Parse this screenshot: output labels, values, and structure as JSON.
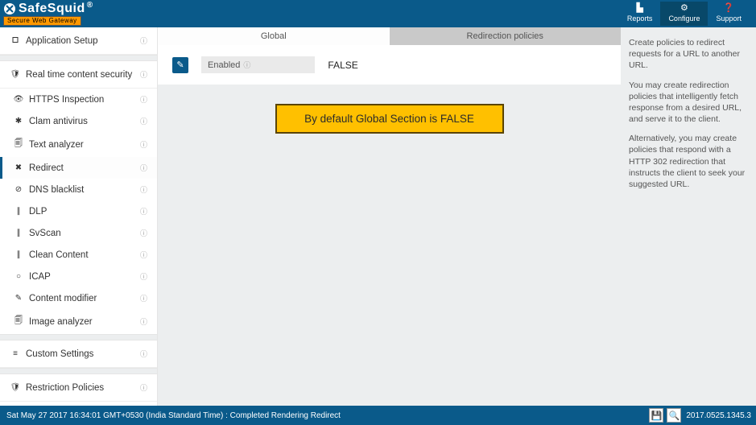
{
  "logo": {
    "text": "SafeSquid",
    "reg": "®",
    "tagline": "Secure Web Gateway"
  },
  "header": {
    "reports": "Reports",
    "configure": "Configure",
    "support": "Support"
  },
  "sidebar": {
    "app_setup": "Application Setup",
    "rtcs": "Real time content security",
    "items": [
      {
        "icon": "👁",
        "label": "HTTPS Inspection"
      },
      {
        "icon": "✱",
        "label": "Clam antivirus"
      },
      {
        "icon": "🗐",
        "label": "Text analyzer"
      },
      {
        "icon": "✖",
        "label": "Redirect"
      },
      {
        "icon": "⊘",
        "label": "DNS blacklist"
      },
      {
        "icon": "∥",
        "label": "DLP"
      },
      {
        "icon": "∥",
        "label": "SvScan"
      },
      {
        "icon": "∥",
        "label": "Clean Content"
      },
      {
        "icon": "○",
        "label": "ICAP"
      },
      {
        "icon": "✎",
        "label": "Content modifier"
      },
      {
        "icon": "🗐",
        "label": "Image analyzer"
      }
    ],
    "custom": "Custom Settings",
    "restriction": "Restriction Policies"
  },
  "tabs": {
    "global": "Global",
    "redir": "Redirection policies"
  },
  "field": {
    "label": "Enabled",
    "value": "FALSE"
  },
  "callout": "By default Global Section is FALSE",
  "help": {
    "p1": "Create policies to redirect requests for a URL to another URL.",
    "p2": "You may create redirection policies that intelligently fetch response from a desired URL, and serve it to the client.",
    "p3": "Alternatively, you may create policies that respond with a HTTP 302 redirection that instructs the client to seek your suggested URL."
  },
  "footer": {
    "status": "Sat May 27 2017 16:34:01 GMT+0530 (India Standard Time) : Completed Rendering Redirect",
    "version": "2017.0525.1345.3"
  }
}
